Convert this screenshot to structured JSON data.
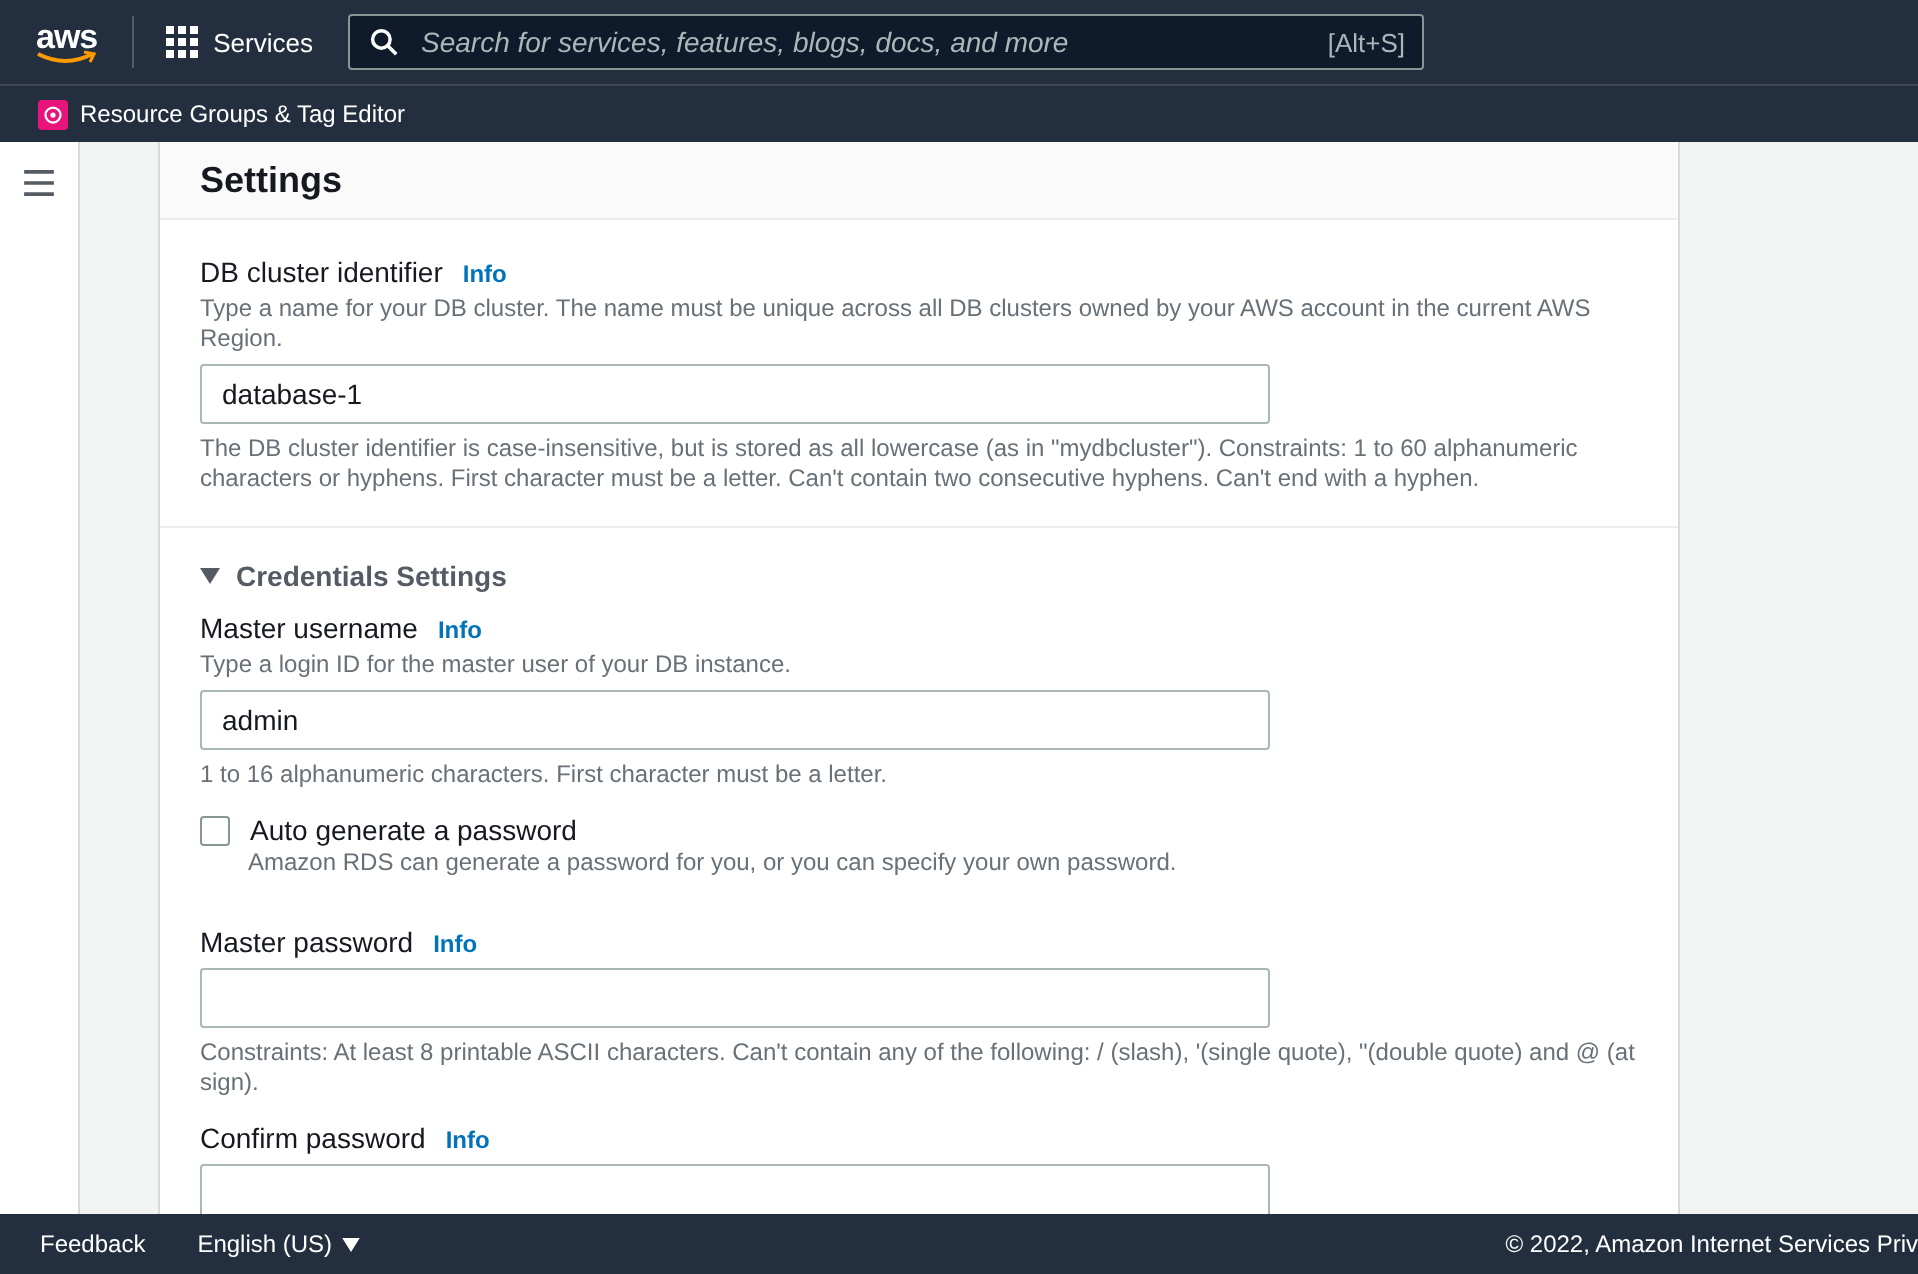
{
  "topbar": {
    "logo": "aws",
    "services": "Services",
    "search": {
      "placeholder": "Search for services, features, blogs, docs, and more",
      "shortcut": "[Alt+S]"
    },
    "favorite": "Resource Groups & Tag Editor"
  },
  "panel": {
    "title": "Settings",
    "sections": [
      {
        "fields": [
          {
            "kind": "input",
            "label": "DB cluster identifier",
            "info": "Info",
            "description": "Type a name for your DB cluster. The name must be unique across all DB clusters owned by your AWS account in the current AWS Region.",
            "value": "database-1",
            "hint": "The DB cluster identifier is case-insensitive, but is stored as all lowercase (as in \"mydbcluster\"). Constraints: 1 to 60 alphanumeric characters or hyphens. First character must be a letter. Can't contain two consecutive hyphens. Can't end with a hyphen."
          }
        ]
      },
      {
        "toggle": {
          "label": "Credentials Settings",
          "expanded": true
        },
        "fields": [
          {
            "kind": "input",
            "label": "Master username",
            "info": "Info",
            "description": "Type a login ID for the master user of your DB instance.",
            "value": "admin",
            "hint": "1 to 16 alphanumeric characters. First character must be a letter."
          },
          {
            "kind": "checkbox",
            "label": "Auto generate a password",
            "checked": false,
            "description": "Amazon RDS can generate a password for you, or you can specify your own password."
          },
          {
            "kind": "input",
            "label": "Master password",
            "info": "Info",
            "hint": "Constraints: At least 8 printable ASCII characters. Can't contain any of the following: / (slash), '(single quote), \"(double quote) and @ (at sign)."
          },
          {
            "kind": "input",
            "label": "Confirm password",
            "info": "Info"
          }
        ]
      }
    ]
  },
  "footer": {
    "feedback": "Feedback",
    "language": "English (US)",
    "copyright": "© 2022, Amazon Internet Services Priv"
  }
}
